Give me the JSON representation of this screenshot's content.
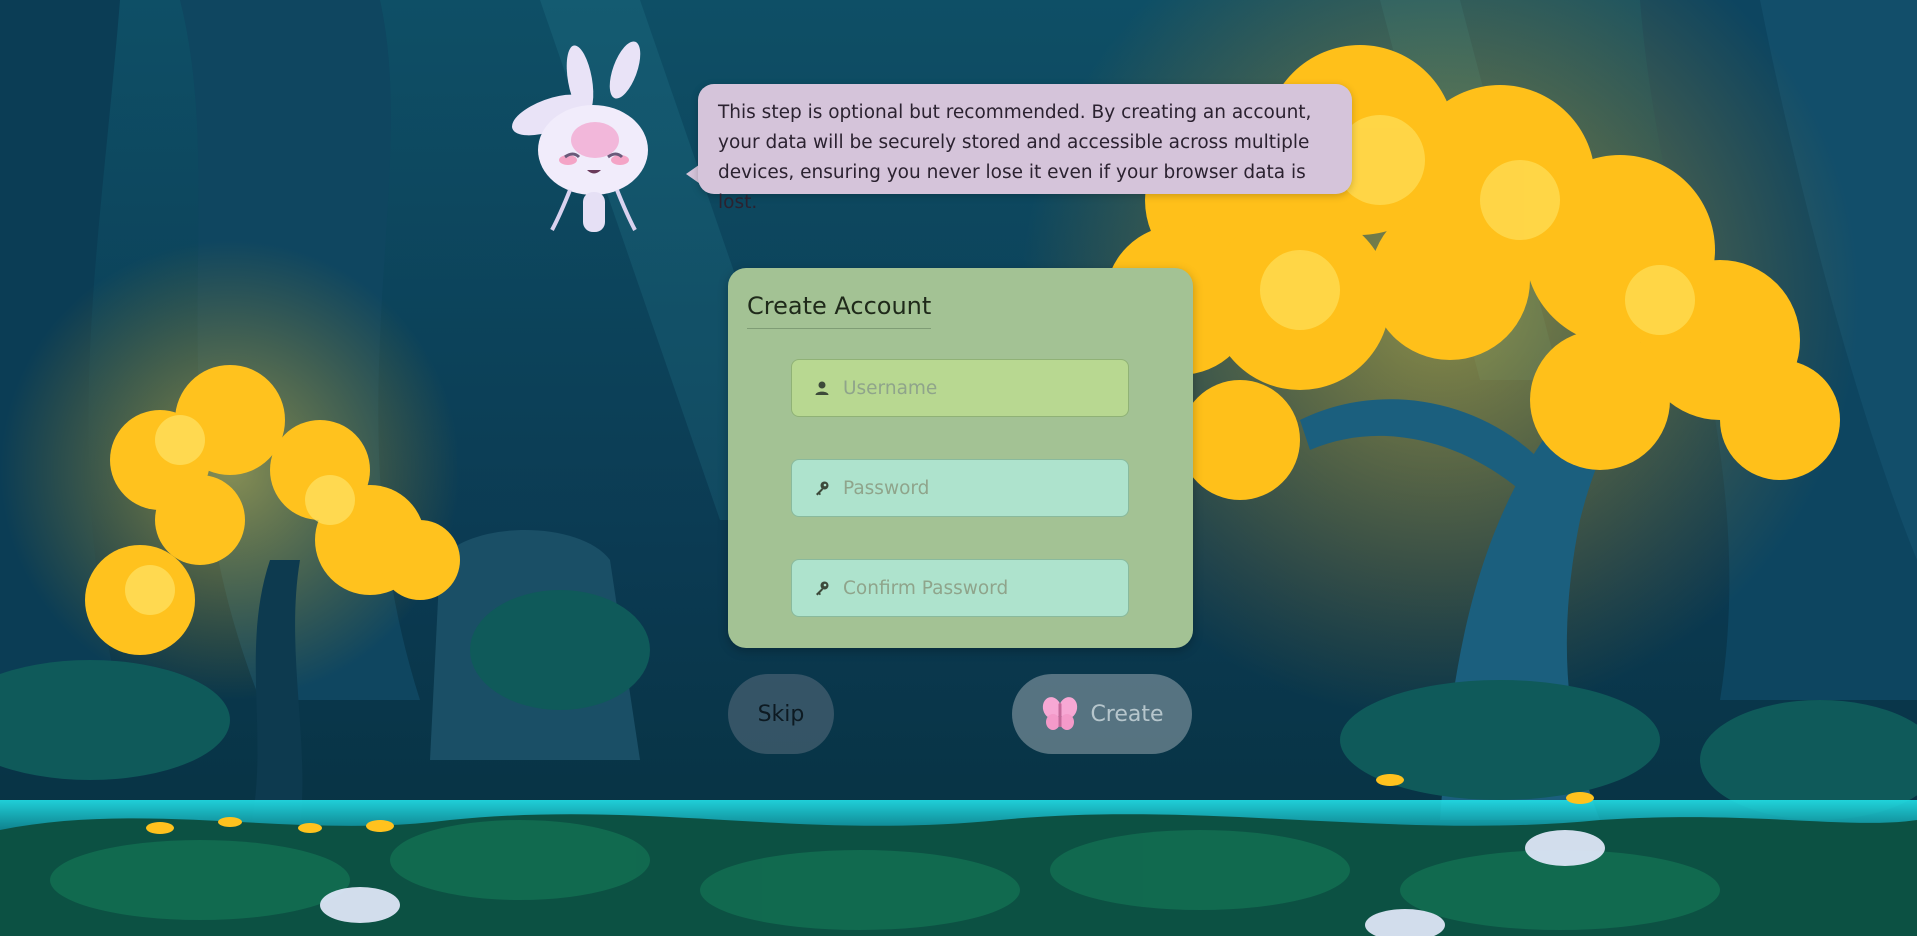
{
  "bubble": {
    "text": "This step is optional but recommended. By creating an account, your data will be securely stored and accessible across multiple devices, ensuring you never lose it even if your browser data is lost."
  },
  "form": {
    "title": "Create Account",
    "username_placeholder": "Username",
    "password_placeholder": "Password",
    "confirm_placeholder": "Confirm Password"
  },
  "buttons": {
    "skip_label": "Skip",
    "create_label": "Create"
  },
  "icons": {
    "username": "user-icon",
    "password": "key-icon",
    "confirm": "key-icon",
    "create": "butterfly-icon"
  },
  "colors": {
    "panel": "#a3c294",
    "bubble": "#d5c4da",
    "username_field": "#b8d891",
    "password_field": "#aee3cd"
  }
}
